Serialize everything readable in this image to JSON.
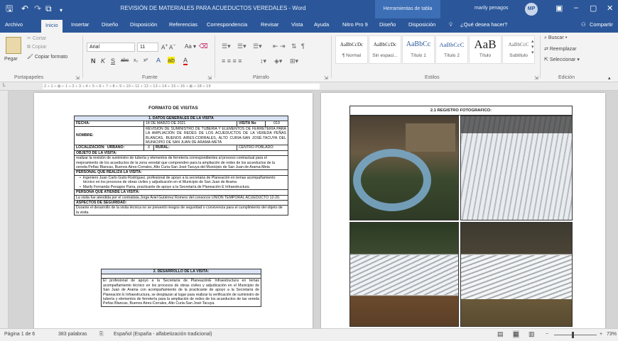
{
  "titlebar": {
    "title": "REVISIÓN DE MATERIALES PARA ACUEDUCTOS VEREDALES - Word",
    "context_tab": "Herramientas de tabla",
    "user": "marily penagos",
    "initials": "MP"
  },
  "tabs": [
    "Archivo",
    "Inicio",
    "Insertar",
    "Diseño",
    "Disposición",
    "Referencias",
    "Correspondencia",
    "Revisar",
    "Vista",
    "Ayuda",
    "Nitro Pro 9",
    "Diseño",
    "Disposición",
    "¿Qué desea hacer?",
    "Compartir"
  ],
  "ribbon": {
    "clipboard": {
      "paste": "Pegar",
      "cut": "Cortar",
      "copy": "Copiar",
      "format": "Copiar formato",
      "label": "Portapapeles"
    },
    "font": {
      "name": "Arial",
      "size": "11",
      "label": "Fuente"
    },
    "paragraph": {
      "label": "Párrafo"
    },
    "styles": {
      "label": "Estilos",
      "items": [
        {
          "preview": "AaBbCcDc",
          "name": "¶ Normal"
        },
        {
          "preview": "AaBbCcDc",
          "name": "Sin espaci..."
        },
        {
          "preview": "AaBbCc",
          "name": "Título 1"
        },
        {
          "preview": "AaBbCcC",
          "name": "Título 2"
        },
        {
          "preview": "AaB",
          "name": "Título"
        },
        {
          "preview": "AaBbCcC",
          "name": "Subtítulo"
        }
      ]
    },
    "editing": {
      "find": "Buscar",
      "replace": "Reemplazar",
      "select": "Seleccionar",
      "label": "Edición"
    }
  },
  "ruler_text": "·2·ı·1·ı·⊠·ı·1·ı·2·ı·3·ı·4·ı·5·ı·6·ı·7·ı·8·ı·9·ı·10·ı·11·ı·12·ı·13·ı·14·ı·15·ı·16·ı·⊠·ı·18·ı·19",
  "document": {
    "title": "FORMATO DE VISITAS",
    "section1": "1.  DATOS GENERALES DE LA VISITA",
    "fecha_label": "FECHA:",
    "fecha": "18 DE MARZO DE 2021",
    "visita_label": "VISITA No",
    "visita_no": "019",
    "nombre_label": "NOMBRE:",
    "nombre": "REVISIÓN DE SUMINISTRO DE TUBERÍA Y ELEMENTOS DE FERRETERÍA PARA LA AMPLIACIÓN DE REDES DE LOS ACUEDUCTOS DE LA VEREDA PEÑAS BLANCAS, BUENOS AIRES-CORRALES, ALTO CURIA-SAN JOSÉ-TACUYA DEL MUNICIPIO DE SAN JUAN DE ARAMA-META",
    "localizacion_label": "LOCALIZACIÓN:",
    "urbano_label": "URBANO:",
    "urbano_value": "X",
    "rural_label": "RURAL:",
    "centro_label": "CENTRO POBLADO:",
    "objeto_label": "OBJETO DE LA VISITA:",
    "objeto": "realizar la revisión de suministro de tubería y elementos de ferretería correspondientes al proceso contractual para el mejoramiento de los acueductos de la zona veredal que comprenden para la ampliación de redes de los acueductos de la vereda Peñas Blancas, Buenos Aires-Corrales, Alto Curia-San José-Tacuya del Municipio de San Juan de Arama-Meta",
    "personal_label": "PERSONAL QUE REALIZA LA VISITA:",
    "personal": [
      "Ingeniero Juan Carlo Guito Rodríguez, profesional de apoyo a la secretaria de Planeación en temas acompañamiento técnico en los procesos de obras civiles y adjudicación en el Municipio de San Juan de Arama",
      "Marily Fernanda Penagos Parra, practicante de apoyo a la Secretaría de Planeación E Infraestructura."
    ],
    "atiende_label": "PERSONA QUE ATIENDE LA VISITA:",
    "atiende": "La visita fue atendida por el contratista Jorge Ariel Gutiérrez Romero del consorcio UNION TEMPORAL ACUEDUCTO 12-20.",
    "seguridad_label": "ASPECTOS DE SEGURIDAD:",
    "seguridad": "Durante el desarrollo de la visita técnica no se presentó riesgos de seguridad o convivencia para el cumplimiento del objeto de la visita.",
    "section2": "2.  DESARROLLO DE LA VISITA:",
    "desarrollo": "El profesional de apoyo a la Secretaría de PlaneaciónE Infraestructura en temas acompañamiento técnico en los procesos de obras civiles y adjudicación en el Municipio de San Juan de Arama con acompañamiento de la practicante de apoyo a la Secretaría de Planeación E Infraestructura, se desplazan al lugar para realizar la verificación de suministro de tubería y elementos de ferretería para la ampliación de redes de los acueductos de las vereda Peñas Blancas, Buenos Aires-Corrales, Alto Curia-San José-Tacuya."
  },
  "page2": {
    "heading": "2.1    REGISTRO FOTOGRAFICO:"
  },
  "status": {
    "page": "Página 1 de 6",
    "words": "383 palabras",
    "language": "Español (España - alfabetización tradicional)",
    "zoom": "73%"
  }
}
